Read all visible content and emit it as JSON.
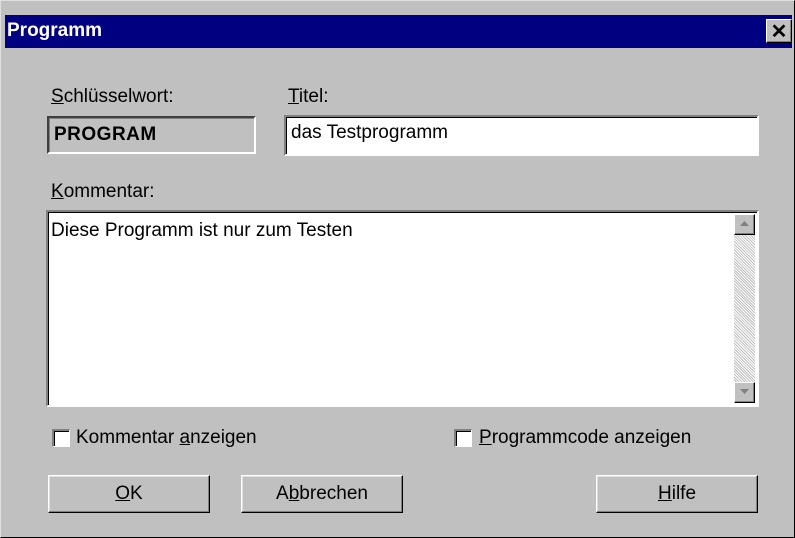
{
  "window": {
    "title": "Programm",
    "close_glyph": "✕"
  },
  "labels": {
    "keyword_prefix_u": "S",
    "keyword_rest": "chlüsselwort:",
    "title_u": "T",
    "title_rest": "itel:",
    "comment_u": "K",
    "comment_rest": "ommentar:"
  },
  "fields": {
    "keyword_value": "PROGRAM",
    "title_value": "das Testprogramm",
    "comment_value": "Diese Programm ist nur zum Testen"
  },
  "checkboxes": {
    "show_comment": {
      "pre": "Kommentar ",
      "u": "a",
      "post": "nzeigen",
      "checked": false
    },
    "show_code": {
      "pre": "",
      "u": "P",
      "post": "rogrammcode anzeigen",
      "checked": false
    }
  },
  "buttons": {
    "ok": {
      "pre": "",
      "u": "O",
      "post": "K"
    },
    "cancel": {
      "pre": "A",
      "u": "b",
      "post": "brechen"
    },
    "help": {
      "pre": "",
      "u": "H",
      "post": "ilfe"
    }
  },
  "icons": {
    "scroll_up": "arrow-up-icon",
    "scroll_down": "arrow-down-icon"
  },
  "colors": {
    "titlebar": "#000080",
    "dialog_bg": "#c0c0c0"
  }
}
